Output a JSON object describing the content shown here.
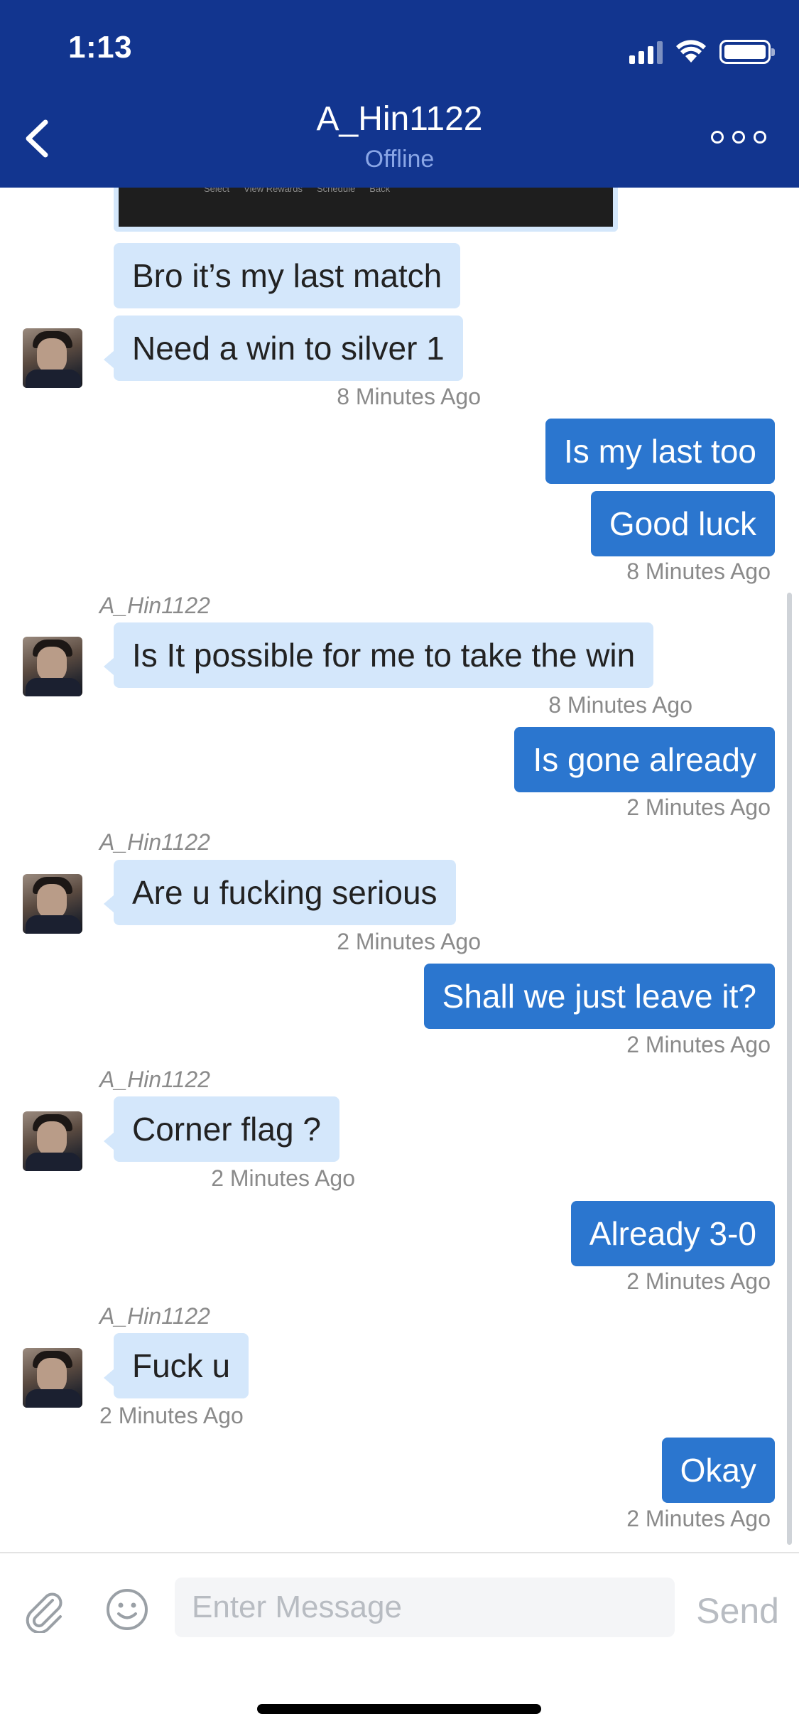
{
  "status_bar": {
    "time": "1:13"
  },
  "header": {
    "title": "A_Hin1122",
    "subtitle": "Offline"
  },
  "image_hints": [
    "Select",
    "View Rewards",
    "Schedule",
    "Back"
  ],
  "messages": [
    {
      "dir": "in",
      "text": "Bro it’s my last match"
    },
    {
      "dir": "in",
      "text": "Need a win to silver 1",
      "time": "8 Minutes Ago"
    },
    {
      "dir": "out",
      "text": "Is my last too"
    },
    {
      "dir": "out",
      "text": "Good luck",
      "time": "8 Minutes Ago"
    },
    {
      "dir": "in",
      "sender": "A_Hin1122",
      "text": "Is It possible for me to take the win",
      "time": "8 Minutes Ago"
    },
    {
      "dir": "out",
      "text": "Is gone already",
      "time": "2 Minutes Ago"
    },
    {
      "dir": "in",
      "sender": "A_Hin1122",
      "text": "Are u fucking serious",
      "time": "2 Minutes Ago"
    },
    {
      "dir": "out",
      "text": "Shall we just leave it?",
      "time": "2 Minutes Ago"
    },
    {
      "dir": "in",
      "sender": "A_Hin1122",
      "text": "Corner flag ?",
      "time": "2 Minutes Ago"
    },
    {
      "dir": "out",
      "text": "Already 3-0",
      "time": "2 Minutes Ago"
    },
    {
      "dir": "in",
      "sender": "A_Hin1122",
      "text": "Fuck u",
      "time": "2 Minutes Ago"
    },
    {
      "dir": "out",
      "text": "Okay",
      "time": "2 Minutes Ago"
    }
  ],
  "input": {
    "placeholder": "Enter Message",
    "send_label": "Send"
  },
  "icons": {
    "back": "chevron-left-icon",
    "more": "more-horizontal-icon",
    "attach": "paperclip-icon",
    "emoji": "smiley-icon",
    "signal": "cellular-signal-icon",
    "wifi": "wifi-icon",
    "battery": "battery-icon"
  },
  "colors": {
    "header_bg": "#12358f",
    "incoming_bubble": "#d4e7fb",
    "outgoing_bubble": "#2b76cf",
    "timestamp": "#8a8a8a"
  }
}
